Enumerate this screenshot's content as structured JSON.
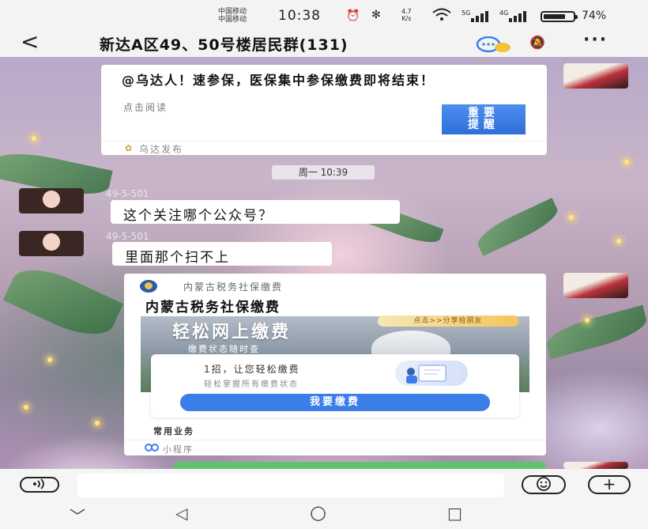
{
  "status_bar": {
    "carrier_1": "中国移动",
    "carrier_2": "中国移动",
    "time": "10:38",
    "speed_value": "4.7",
    "speed_unit": "K/s",
    "net_1": "5G",
    "net_2": "4G",
    "battery_level": 0.74,
    "battery_text": "74%"
  },
  "header": {
    "back": "<",
    "title": "新达A区49、50号楼居民群(131)",
    "more": "···"
  },
  "messages": {
    "article": {
      "title": "@乌达人！速参保，医保集中参保缴费即将结束！",
      "subtitle": "点击阅读",
      "badge_line1": "重要",
      "badge_line2": "提醒",
      "source": "乌达发布"
    },
    "time_divider": "周一 10:39",
    "msg1": {
      "sender": "49-5-501",
      "text": "这个关注哪个公众号？"
    },
    "msg2": {
      "sender": "49-5-501",
      "text": "里面那个扫不上"
    },
    "mini_program": {
      "source": "内蒙古税务社保缴费",
      "title": "内蒙古税务社保缴费",
      "banner_title": "轻松网上缴费",
      "banner_subtitle": "缴费状态随时查",
      "share_tag": "点击>>分享给朋友",
      "inner_line1": "1招，让您轻松缴费",
      "inner_line2": "轻松掌握所有缴费状态",
      "pay_button": "我要缴费",
      "common_services": "常用业务",
      "footer": "小程序"
    }
  },
  "input_bar": {
    "voice_icon": "voice-icon",
    "placeholder": "",
    "emoji_icon": "emoji-icon",
    "plus": "+"
  },
  "nav_bar": {
    "down": "﹀",
    "back": "◁",
    "home": "○",
    "recents": "□"
  }
}
